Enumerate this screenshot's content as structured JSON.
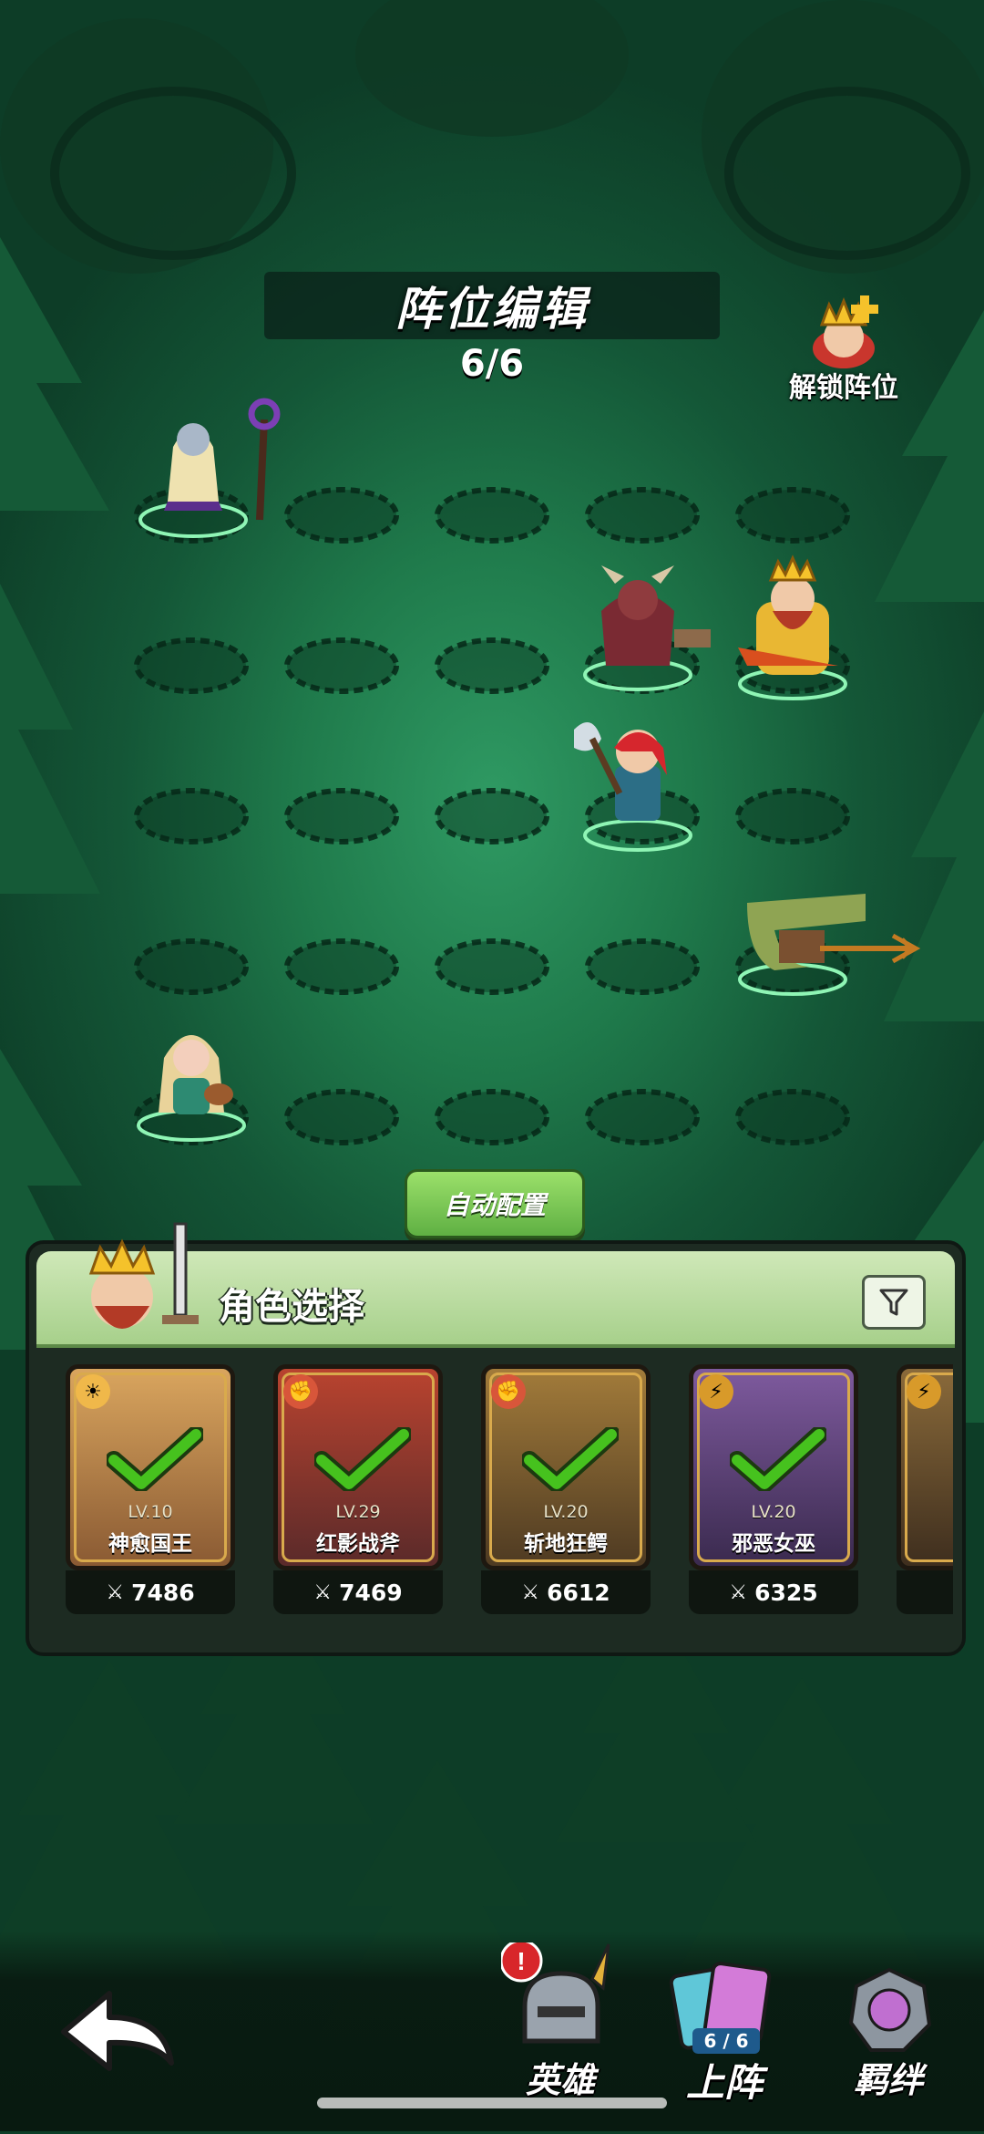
{
  "header": {
    "title": "阵位编辑",
    "count": "6/6"
  },
  "unlock_button": {
    "label": "解锁阵位"
  },
  "auto_button": {
    "label": "自动配置"
  },
  "roster_panel": {
    "title": "角色选择",
    "cards": [
      {
        "level": "LV.10",
        "name": "神愈国王",
        "power": "7486",
        "element": "sun-icon",
        "checked": true
      },
      {
        "level": "LV.29",
        "name": "红影战斧",
        "power": "7469",
        "element": "strength-icon",
        "checked": true
      },
      {
        "level": "LV.20",
        "name": "斩地狂鳄",
        "power": "6612",
        "element": "strength-icon",
        "checked": true
      },
      {
        "level": "LV.20",
        "name": "邪恶女巫",
        "power": "6325",
        "element": "lightning-icon",
        "checked": true
      }
    ]
  },
  "bottom_nav": {
    "heroes": {
      "label": "英雄"
    },
    "lineup": {
      "label": "上阵",
      "badge": "6 / 6"
    },
    "bonds": {
      "label": "羁绊"
    }
  },
  "colors": {
    "accent_green": "#5fb043",
    "check_green": "#46c21e",
    "card_gold": "#d9aa4c",
    "alert_red": "#d8262a"
  }
}
